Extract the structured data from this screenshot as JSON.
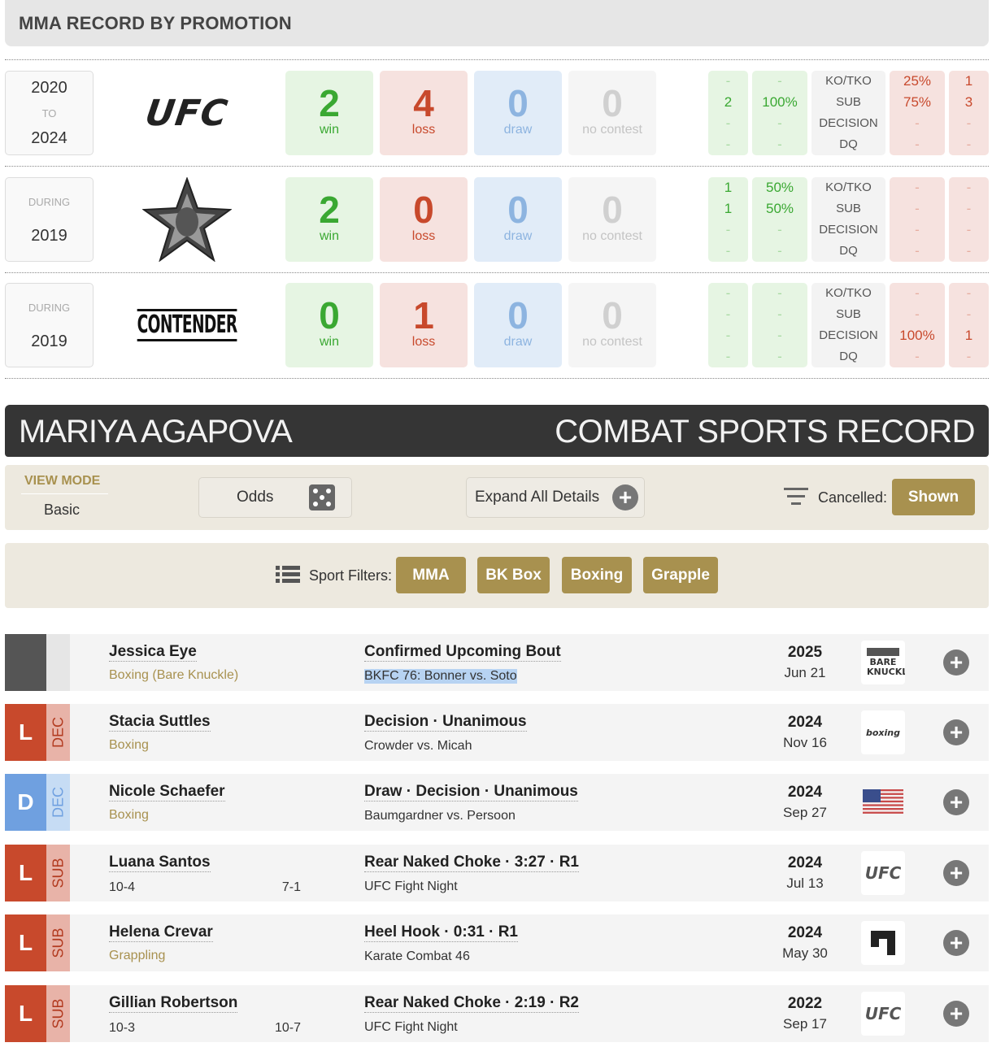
{
  "promo_section": {
    "title": "MMA RECORD BY PROMOTION",
    "rows": [
      {
        "year_top": "2020",
        "year_mid": "TO",
        "year_bottom": "2024",
        "logo": "ufc-logo",
        "logo_text": "UFC",
        "win": "2",
        "loss": "4",
        "draw": "0",
        "nc": "0",
        "win_counts": [
          "-",
          "2",
          "-",
          "-"
        ],
        "win_pcts": [
          "-",
          "100%",
          "-",
          "-"
        ],
        "loss_pcts": [
          "25%",
          "75%",
          "-",
          "-"
        ],
        "loss_counts": [
          "1",
          "3",
          "-",
          "-"
        ]
      },
      {
        "year_top": "DURING",
        "year_mid": "",
        "year_bottom": "2019",
        "logo": "star-eagle-logo",
        "logo_text": "",
        "win": "2",
        "loss": "0",
        "draw": "0",
        "nc": "0",
        "win_counts": [
          "1",
          "1",
          "-",
          "-"
        ],
        "win_pcts": [
          "50%",
          "50%",
          "-",
          "-"
        ],
        "loss_pcts": [
          "-",
          "-",
          "-",
          "-"
        ],
        "loss_counts": [
          "-",
          "-",
          "-",
          "-"
        ]
      },
      {
        "year_top": "DURING",
        "year_mid": "",
        "year_bottom": "2019",
        "logo": "contender-series-logo",
        "logo_text": "CONTENDER",
        "win": "0",
        "loss": "1",
        "draw": "0",
        "nc": "0",
        "win_counts": [
          "-",
          "-",
          "-",
          "-"
        ],
        "win_pcts": [
          "-",
          "-",
          "-",
          "-"
        ],
        "loss_pcts": [
          "-",
          "-",
          "100%",
          "-"
        ],
        "loss_counts": [
          "-",
          "-",
          "1",
          "-"
        ]
      }
    ],
    "labels": {
      "win": "win",
      "loss": "loss",
      "draw": "draw",
      "nc": "no contest"
    },
    "methods": [
      "KO/TKO",
      "SUB",
      "DECISION",
      "DQ"
    ]
  },
  "record_header": {
    "name": "MARIYA AGAPOVA",
    "title": "COMBAT SPORTS RECORD"
  },
  "view_bar": {
    "view_mode_label": "VIEW MODE",
    "view_mode_value": "Basic",
    "odds_label": "Odds",
    "expand_label": "Expand All Details",
    "cancelled_label": "Cancelled:",
    "cancelled_value": "Shown"
  },
  "sport_filters": {
    "label": "Sport Filters:",
    "items": [
      "MMA",
      "BK Box",
      "Boxing",
      "Grapple"
    ]
  },
  "fights": [
    {
      "result": "",
      "method": "",
      "opponent": "Jessica Eye",
      "sub": "Boxing (Bare Knuckle)",
      "rec_a": "",
      "rec_b": "",
      "outcome": "Confirmed Upcoming Bout",
      "event": "BKFC 76: Bonner vs. Soto",
      "year": "2025",
      "date": "Jun 21",
      "logo": "bare-knuckle-logo",
      "logo_text": "BARE KNUCKLE"
    },
    {
      "result": "L",
      "method": "DEC",
      "opponent": "Stacia Suttles",
      "sub": "Boxing",
      "rec_a": "",
      "rec_b": "",
      "outcome": "Decision · Unanimous",
      "event": "Crowder vs. Micah",
      "year": "2024",
      "date": "Nov 16",
      "logo": "boxing-logo",
      "logo_text": "boxing"
    },
    {
      "result": "D",
      "method": "DEC",
      "opponent": "Nicole Schaefer",
      "sub": "Boxing",
      "rec_a": "",
      "rec_b": "",
      "outcome": "Draw · Decision · Unanimous",
      "event": "Baumgardner vs. Persoon",
      "year": "2024",
      "date": "Sep 27",
      "logo": "us-flag-icon",
      "logo_text": ""
    },
    {
      "result": "L",
      "method": "SUB",
      "opponent": "Luana Santos",
      "sub": "",
      "rec_a": "10-4",
      "rec_b": "7-1",
      "outcome": "Rear Naked Choke · 3:27 · R1",
      "event": "UFC Fight Night",
      "year": "2024",
      "date": "Jul 13",
      "logo": "ufc-logo",
      "logo_text": "UFC"
    },
    {
      "result": "L",
      "method": "SUB",
      "opponent": "Helena Crevar",
      "sub": "Grappling",
      "rec_a": "",
      "rec_b": "",
      "outcome": "Heel Hook · 0:31 · R1",
      "event": "Karate Combat 46",
      "year": "2024",
      "date": "May 30",
      "logo": "karate-combat-logo",
      "logo_text": ""
    },
    {
      "result": "L",
      "method": "SUB",
      "opponent": "Gillian Robertson",
      "sub": "",
      "rec_a": "10-3",
      "rec_b": "10-7",
      "outcome": "Rear Naked Choke · 2:19 · R2",
      "event": "UFC Fight Night",
      "year": "2022",
      "date": "Sep 17",
      "logo": "ufc-logo",
      "logo_text": "UFC"
    }
  ],
  "colors": {
    "gold": "#a8914f",
    "loss": "#c8492c",
    "win": "#3aa832",
    "draw": "#8db4e0",
    "dark": "#353535"
  }
}
